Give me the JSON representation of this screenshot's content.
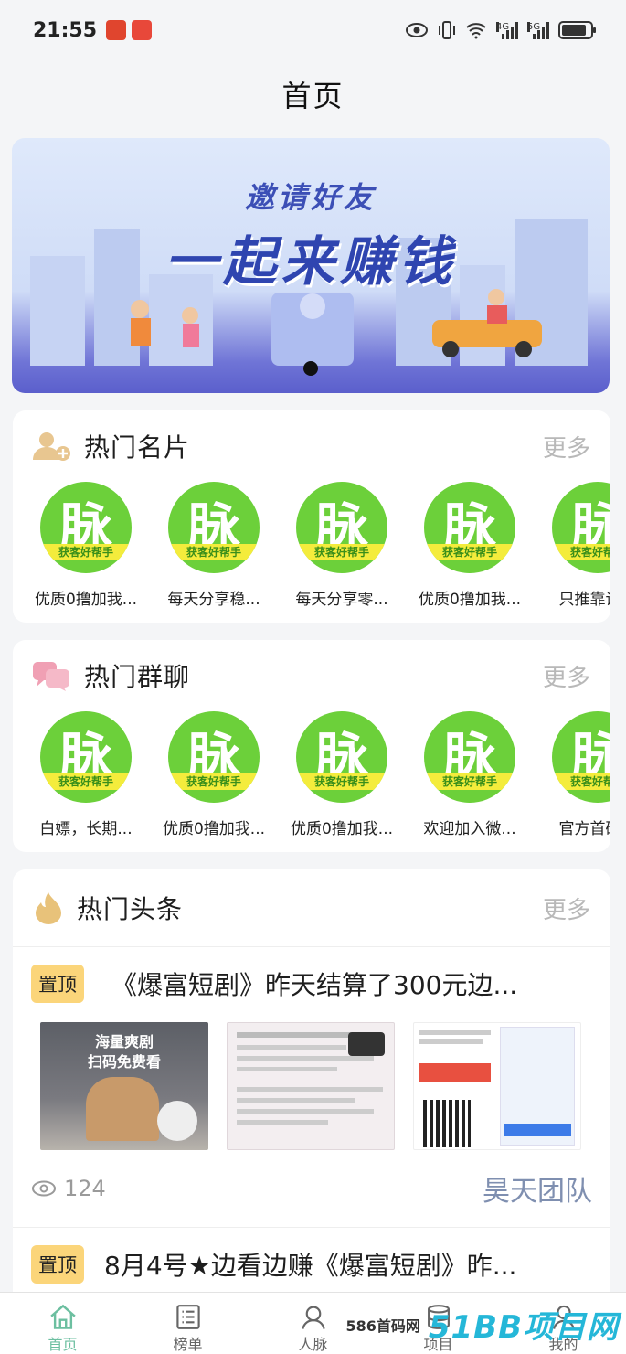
{
  "status_bar": {
    "time": "21:55",
    "net_left": "4G",
    "net_right": "5G",
    "battery_level": 0.85
  },
  "page": {
    "title": "首页"
  },
  "banner": {
    "subtitle": "邀请好友",
    "headline": "一起来赚钱",
    "active_slide": 1
  },
  "hot_cards": {
    "title": "热门名片",
    "more": "更多",
    "avatar_text": "脉",
    "avatar_band": "获客好帮手",
    "items": [
      {
        "label": "优质0撸加我..."
      },
      {
        "label": "每天分享稳..."
      },
      {
        "label": "每天分享零..."
      },
      {
        "label": "优质0撸加我..."
      },
      {
        "label": "只推靠谱项"
      }
    ]
  },
  "hot_groups": {
    "title": "热门群聊",
    "more": "更多",
    "avatar_text": "脉",
    "avatar_band": "获客好帮手",
    "items": [
      {
        "label": "白嫖，长期..."
      },
      {
        "label": "优质0撸加我..."
      },
      {
        "label": "优质0撸加我..."
      },
      {
        "label": "欢迎加入微..."
      },
      {
        "label": "官方首码发"
      }
    ]
  },
  "hot_news": {
    "title": "热门头条",
    "more": "更多",
    "items": [
      {
        "badge": "置顶",
        "title": "《爆富短剧》昨天结算了300元边...",
        "views": "124",
        "author": "昊天团队",
        "thumb1_line1": "海量爽剧",
        "thumb1_line2": "扫码免费看"
      },
      {
        "badge": "置顶",
        "title": "8月4号★边看边赚《爆富短剧》昨..."
      }
    ]
  },
  "tabbar": {
    "items": [
      {
        "label": "首页",
        "icon": "home-icon",
        "active": true
      },
      {
        "label": "榜单",
        "icon": "list-icon",
        "active": false
      },
      {
        "label": "人脉",
        "icon": "contacts-icon",
        "active": false
      },
      {
        "label": "项目",
        "icon": "database-icon",
        "active": false
      },
      {
        "label": "我的",
        "icon": "profile-icon",
        "active": false
      }
    ]
  },
  "watermark": {
    "text": "586首码网",
    "logo": "51BB项目网"
  },
  "colors": {
    "accent_green": "#6cd03a",
    "tab_active": "#6cbfa0",
    "badge": "#fbd57a",
    "banner_text": "#2f45b0"
  }
}
